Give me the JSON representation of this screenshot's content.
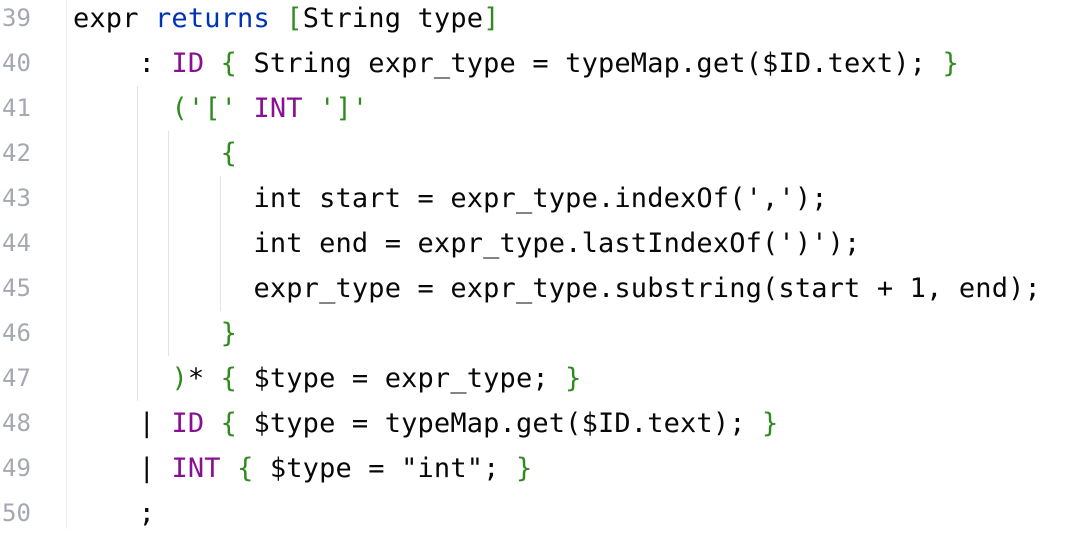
{
  "editor": {
    "line_numbers": [
      "39",
      "40",
      "41",
      "42",
      "43",
      "44",
      "45",
      "46",
      "47",
      "48",
      "49",
      "50"
    ],
    "lines": [
      [
        {
          "t": "expr ",
          "c": "pl"
        },
        {
          "t": "returns",
          "c": "kw"
        },
        {
          "t": " ",
          "c": "pl"
        },
        {
          "t": "[",
          "c": "br"
        },
        {
          "t": "String type",
          "c": "pl"
        },
        {
          "t": "]",
          "c": "br"
        }
      ],
      [
        {
          "t": "    : ",
          "c": "pl"
        },
        {
          "t": "ID",
          "c": "tk"
        },
        {
          "t": " ",
          "c": "pl"
        },
        {
          "t": "{",
          "c": "br"
        },
        {
          "t": " String expr_type = typeMap.get($ID.text); ",
          "c": "pl"
        },
        {
          "t": "}",
          "c": "br"
        }
      ],
      [
        {
          "t": "      ",
          "c": "pl"
        },
        {
          "t": "(",
          "c": "br"
        },
        {
          "t": "'['",
          "c": "br"
        },
        {
          "t": " ",
          "c": "pl"
        },
        {
          "t": "INT",
          "c": "tk"
        },
        {
          "t": " ",
          "c": "pl"
        },
        {
          "t": "']'",
          "c": "br"
        }
      ],
      [
        {
          "t": "         ",
          "c": "pl"
        },
        {
          "t": "{",
          "c": "br"
        }
      ],
      [
        {
          "t": "           int start = expr_type.indexOf(',');",
          "c": "pl"
        }
      ],
      [
        {
          "t": "           int end = expr_type.lastIndexOf(')');",
          "c": "pl"
        }
      ],
      [
        {
          "t": "           expr_type = expr_type.substring(start + 1, end);",
          "c": "pl"
        }
      ],
      [
        {
          "t": "         ",
          "c": "pl"
        },
        {
          "t": "}",
          "c": "br"
        }
      ],
      [
        {
          "t": "      ",
          "c": "pl"
        },
        {
          "t": ")",
          "c": "br"
        },
        {
          "t": "* ",
          "c": "pl"
        },
        {
          "t": "{",
          "c": "br"
        },
        {
          "t": " $type = expr_type; ",
          "c": "pl"
        },
        {
          "t": "}",
          "c": "br"
        }
      ],
      [
        {
          "t": "    | ",
          "c": "pl"
        },
        {
          "t": "ID",
          "c": "tk"
        },
        {
          "t": " ",
          "c": "pl"
        },
        {
          "t": "{",
          "c": "br"
        },
        {
          "t": " $type = typeMap.get($ID.text); ",
          "c": "pl"
        },
        {
          "t": "}",
          "c": "br"
        }
      ],
      [
        {
          "t": "    | ",
          "c": "pl"
        },
        {
          "t": "INT",
          "c": "tk"
        },
        {
          "t": " ",
          "c": "pl"
        },
        {
          "t": "{",
          "c": "br"
        },
        {
          "t": " $type = \"int\"; ",
          "c": "pl"
        },
        {
          "t": "}",
          "c": "br"
        }
      ],
      [
        {
          "t": "    ;",
          "c": "pl"
        }
      ]
    ]
  },
  "colors": {
    "background": "#ffffff",
    "line_number": "#a4a8b1",
    "keyword": "#0033b3",
    "token": "#871094",
    "brace": "#2f8a1f",
    "text": "#080808",
    "indent_guide": "#dfe8d8"
  }
}
